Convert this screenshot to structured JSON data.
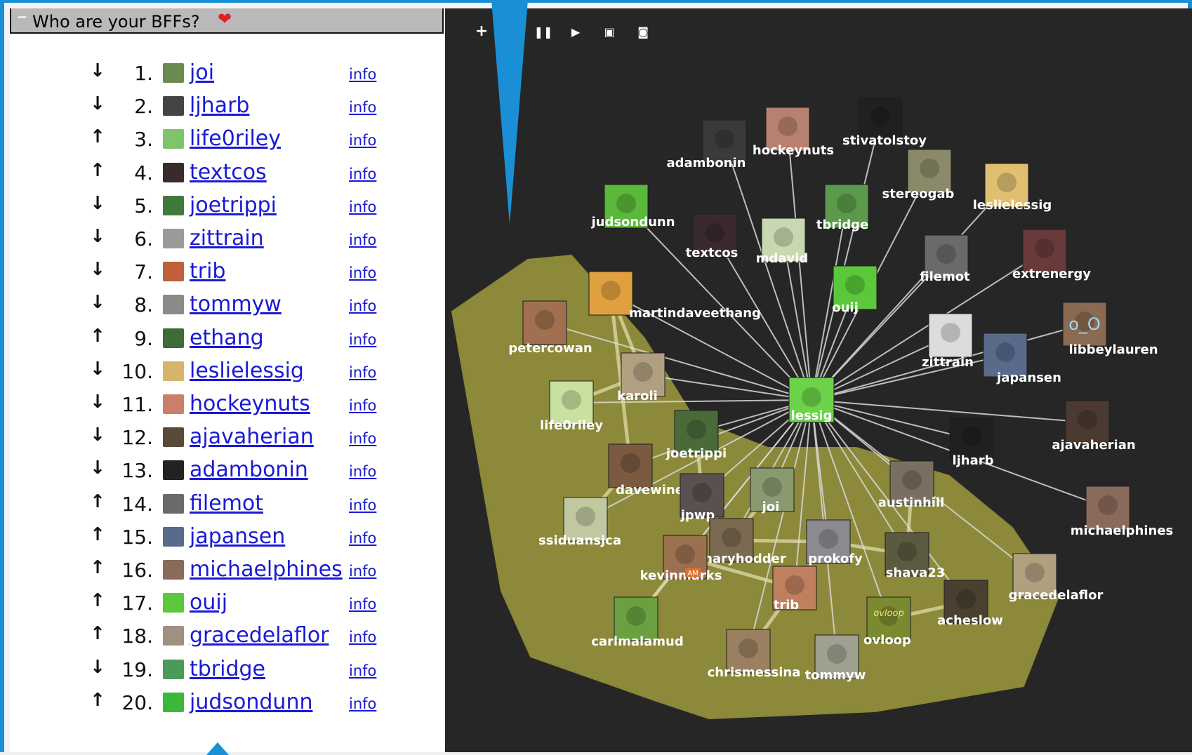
{
  "panel": {
    "title": "Who are your BFFs?",
    "collapse": "−",
    "heart": "❤"
  },
  "bffs": [
    {
      "dir": "down",
      "rank": "1.",
      "name": "joi",
      "info": "info",
      "color": "#6b8a50"
    },
    {
      "dir": "down",
      "rank": "2.",
      "name": "ljharb",
      "info": "info",
      "color": "#444444"
    },
    {
      "dir": "up",
      "rank": "3.",
      "name": "life0riley",
      "info": "info",
      "color": "#7fc46a"
    },
    {
      "dir": "up",
      "rank": "4.",
      "name": "textcos",
      "info": "info",
      "color": "#3a2a2a"
    },
    {
      "dir": "down",
      "rank": "5.",
      "name": "joetrippi",
      "info": "info",
      "color": "#3f7a3a"
    },
    {
      "dir": "down",
      "rank": "6.",
      "name": "zittrain",
      "info": "info",
      "color": "#9a9a9a"
    },
    {
      "dir": "down",
      "rank": "7.",
      "name": "trib",
      "info": "info",
      "color": "#c0603a"
    },
    {
      "dir": "down",
      "rank": "8.",
      "name": "tommyw",
      "info": "info",
      "color": "#8a8a8a"
    },
    {
      "dir": "up",
      "rank": "9.",
      "name": "ethang",
      "info": "info",
      "color": "#3f6a3a"
    },
    {
      "dir": "down",
      "rank": "10.",
      "name": "leslielessig",
      "info": "info",
      "color": "#d6b46a"
    },
    {
      "dir": "down",
      "rank": "11.",
      "name": "hockeynuts",
      "info": "info",
      "color": "#c9806a"
    },
    {
      "dir": "down",
      "rank": "12.",
      "name": "ajavaherian",
      "info": "info",
      "color": "#5a4a3a"
    },
    {
      "dir": "down",
      "rank": "13.",
      "name": "adambonin",
      "info": "info",
      "color": "#222222"
    },
    {
      "dir": "up",
      "rank": "14.",
      "name": "filemot",
      "info": "info",
      "color": "#6a6a6a"
    },
    {
      "dir": "up",
      "rank": "15.",
      "name": "japansen",
      "info": "info",
      "color": "#5a6a8a"
    },
    {
      "dir": "up",
      "rank": "16.",
      "name": "michaelphines",
      "info": "info",
      "color": "#8a6a5a"
    },
    {
      "dir": "up",
      "rank": "17.",
      "name": "ouij",
      "info": "info",
      "color": "#5ac83a"
    },
    {
      "dir": "up",
      "rank": "18.",
      "name": "gracedelaflor",
      "info": "info",
      "color": "#a09080"
    },
    {
      "dir": "down",
      "rank": "19.",
      "name": "tbridge",
      "info": "info",
      "color": "#4a9a5a"
    },
    {
      "dir": "up",
      "rank": "20.",
      "name": "judsondunn",
      "info": "info",
      "color": "#3ab83a"
    }
  ],
  "controls": [
    {
      "name": "add-button",
      "glyph": "+"
    },
    {
      "name": "pause-button",
      "glyph": "❚❚"
    },
    {
      "name": "play-button",
      "glyph": "▶"
    },
    {
      "name": "save-button",
      "glyph": "▣"
    },
    {
      "name": "camera-button",
      "glyph": "◙"
    }
  ],
  "graph": {
    "center": "lessig",
    "nodes": [
      {
        "label": "lessig",
        "color": "#6bd24a"
      },
      {
        "label": "adambonin",
        "color": "#3a3a3a"
      },
      {
        "label": "hockeynuts",
        "color": "#b88070"
      },
      {
        "label": "stivatolstoy",
        "color": "#202020"
      },
      {
        "label": "stereogab",
        "color": "#8a8a6a"
      },
      {
        "label": "leslielessig",
        "color": "#e0c070"
      },
      {
        "label": "judsondunn",
        "color": "#5ab83a"
      },
      {
        "label": "tbridge",
        "color": "#5a9a4a"
      },
      {
        "label": "textcos",
        "color": "#3a2a30"
      },
      {
        "label": "mdavid",
        "color": "#c8d8b0"
      },
      {
        "label": "filemot",
        "color": "#6a6a6a"
      },
      {
        "label": "extrenergy",
        "color": "#6a3a3a"
      },
      {
        "label": "ouij",
        "color": "#5ac83a"
      },
      {
        "label": "martindaveethang",
        "color": "#e0a040"
      },
      {
        "label": "petercowan",
        "color": "#a07050"
      },
      {
        "label": "zittrain",
        "color": "#dcdcdc"
      },
      {
        "label": "libbeylauren",
        "color": "#8a6a50"
      },
      {
        "label": "japansen",
        "color": "#5a6a8a"
      },
      {
        "label": "karoli",
        "color": "#b0a080"
      },
      {
        "label": "life0riley",
        "color": "#c8e0a0"
      },
      {
        "label": "joetrippi",
        "color": "#4a6a3a"
      },
      {
        "label": "ljharb",
        "color": "#202020"
      },
      {
        "label": "ajavaherian",
        "color": "#4a3a30"
      },
      {
        "label": "davewiner",
        "color": "#7a5a40"
      },
      {
        "label": "jpwp",
        "color": "#5a5050"
      },
      {
        "label": "joi",
        "color": "#8a9a70"
      },
      {
        "label": "austinhill",
        "color": "#7a7060"
      },
      {
        "label": "michaelphines",
        "color": "#8a6a5a"
      },
      {
        "label": "ssiduansjca",
        "color": "#c0c8a0"
      },
      {
        "label": "maryhodder",
        "color": "#7a6a50"
      },
      {
        "label": "prokofy",
        "color": "#8a8a90"
      },
      {
        "label": "kevinmarks",
        "color": "#9a7050"
      },
      {
        "label": "shava23",
        "color": "#5a5a40"
      },
      {
        "label": "gracedelaflor",
        "color": "#b0a080"
      },
      {
        "label": "trib",
        "color": "#c08060"
      },
      {
        "label": "acheslow",
        "color": "#4a4030"
      },
      {
        "label": "carlmalamud",
        "color": "#6aa040"
      },
      {
        "label": "ovloop",
        "color": "#7a8a30"
      },
      {
        "label": "chrismessina",
        "color": "#9a8060"
      },
      {
        "label": "tommyw",
        "color": "#a0a090"
      }
    ],
    "avatar_text_libbeylauren": "o_O",
    "avatar_text_ovloop": "ovloop",
    "badge_kevinmarks": "AM"
  }
}
